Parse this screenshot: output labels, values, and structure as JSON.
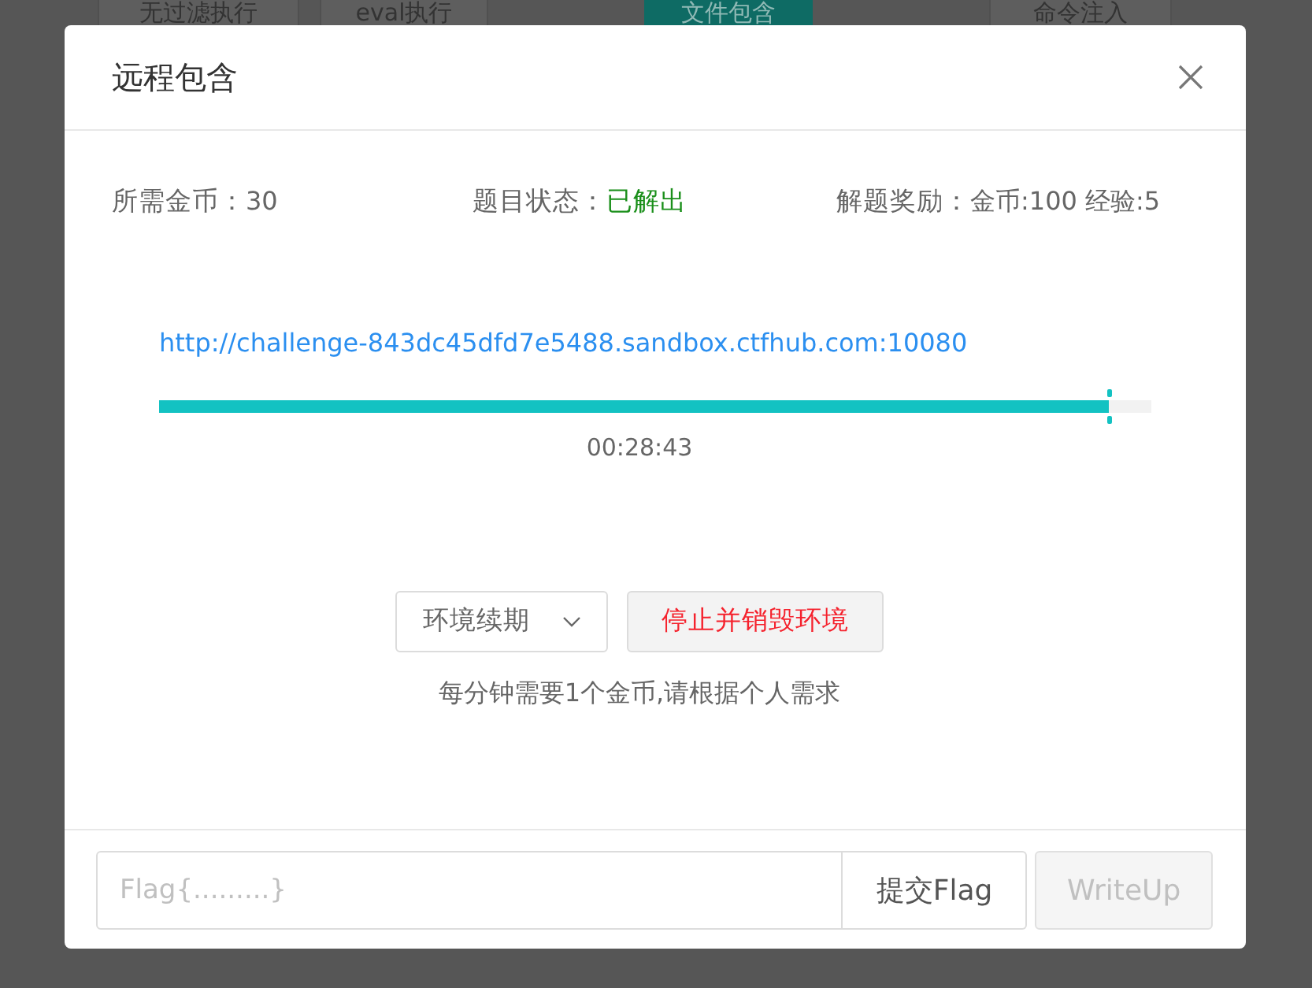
{
  "background_tabs": [
    {
      "label": "无过滤执行",
      "selected": false
    },
    {
      "label": "eval执行",
      "selected": false
    },
    {
      "label": "文件包含",
      "selected": true
    },
    {
      "label": "命令注入",
      "selected": false
    }
  ],
  "dialog": {
    "title": "远程包含",
    "info": [
      {
        "kind": "plain",
        "label": "所需金币：",
        "value": "30"
      },
      {
        "kind": "status",
        "label": "题目状态：",
        "value": "已解出"
      },
      {
        "kind": "plain",
        "label": "解题奖励：",
        "value": "金币:100 经验:5"
      }
    ],
    "url": "http://challenge-843dc45dfd7e5488.sandbox.ctfhub.com:10080",
    "timer": {
      "level": 0.957,
      "reading": "00:28:43"
    },
    "renew_dropdown": {
      "label": "环境续期"
    },
    "stop_button": {
      "label": "停止并销毁环境"
    },
    "note": "每分钟需要1个金币,请根据个人需求",
    "flag_field": {
      "placeholder": "Flag{.........}"
    },
    "submit_button": {
      "label": "提交Flag"
    },
    "writeup_button": {
      "label": "WriteUp",
      "disabled": true
    }
  }
}
